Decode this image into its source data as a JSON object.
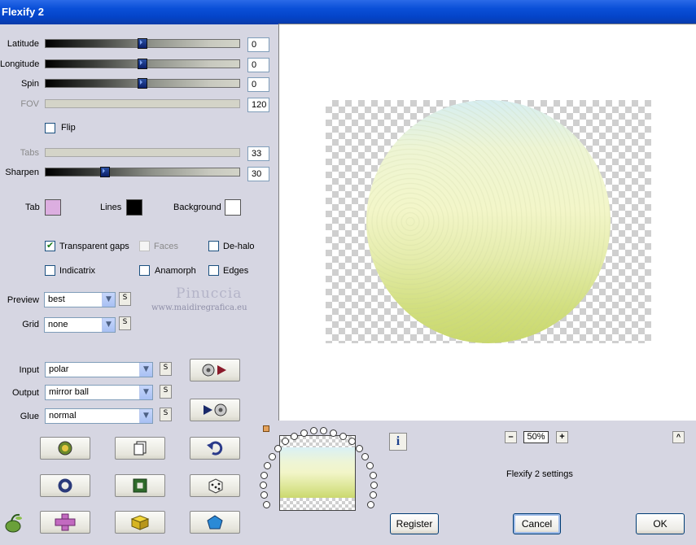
{
  "window": {
    "title": "Flexify 2"
  },
  "sliders": [
    {
      "label": "Latitude",
      "value": "0",
      "level": 0.5,
      "enabled": true
    },
    {
      "label": "Longitude",
      "value": "0",
      "level": 0.5,
      "enabled": true
    },
    {
      "label": "Spin",
      "value": "0",
      "level": 0.5,
      "enabled": true
    },
    {
      "label": "FOV",
      "value": "120",
      "enabled": false
    },
    {
      "label": "Tabs",
      "value": "33",
      "enabled": false
    },
    {
      "label": "Sharpen",
      "value": "30",
      "level": 0.3,
      "enabled": true
    }
  ],
  "flip": {
    "label": "Flip",
    "checked": false
  },
  "colors": {
    "tab": {
      "label": "Tab",
      "color": "#dcaee0"
    },
    "lines": {
      "label": "Lines",
      "color": "#000000"
    },
    "background": {
      "label": "Background",
      "color": "#ffffff"
    }
  },
  "options": {
    "transparent_gaps": {
      "label": "Transparent gaps",
      "checked": true
    },
    "faces": {
      "label": "Faces",
      "checked": false,
      "enabled": false
    },
    "de_halo": {
      "label": "De-halo",
      "checked": false
    },
    "indicatrix": {
      "label": "Indicatrix",
      "checked": false
    },
    "anamorph": {
      "label": "Anamorph",
      "checked": false
    },
    "edges": {
      "label": "Edges",
      "checked": false
    }
  },
  "preview_select": {
    "label": "Preview",
    "value": "best",
    "s_label": "S"
  },
  "grid_select": {
    "label": "Grid",
    "value": "none",
    "s_label": "S"
  },
  "input_select": {
    "label": "Input",
    "value": "polar",
    "s_label": "S"
  },
  "output_select": {
    "label": "Output",
    "value": "mirror ball",
    "s_label": "S"
  },
  "glue_select": {
    "label": "Glue",
    "value": "normal",
    "s_label": "S"
  },
  "watermark": {
    "line1": "Pinuccia",
    "line2": "www.maidiregrafica.eu"
  },
  "zoom": {
    "value": "50%",
    "minus": "–",
    "plus": "+"
  },
  "settings_label": "Flexify 2 settings",
  "caret": "^",
  "buttons": {
    "register": "Register",
    "cancel": "Cancel",
    "ok": "OK"
  },
  "icons": {
    "info": "i",
    "tool_buttons": [
      "randomize-globe-icon",
      "copy-icon",
      "undo-icon",
      "ring-icon",
      "square-frame-icon",
      "dice-icon",
      "plus-shape-icon",
      "cube-icon",
      "pentagon-icon"
    ],
    "play_buttons": [
      "disc-forward-icon",
      "disc-back-icon"
    ]
  },
  "accent_colors": {
    "title_bar": "#0a4fd8",
    "slider_thumb": "#1a3a8a"
  }
}
